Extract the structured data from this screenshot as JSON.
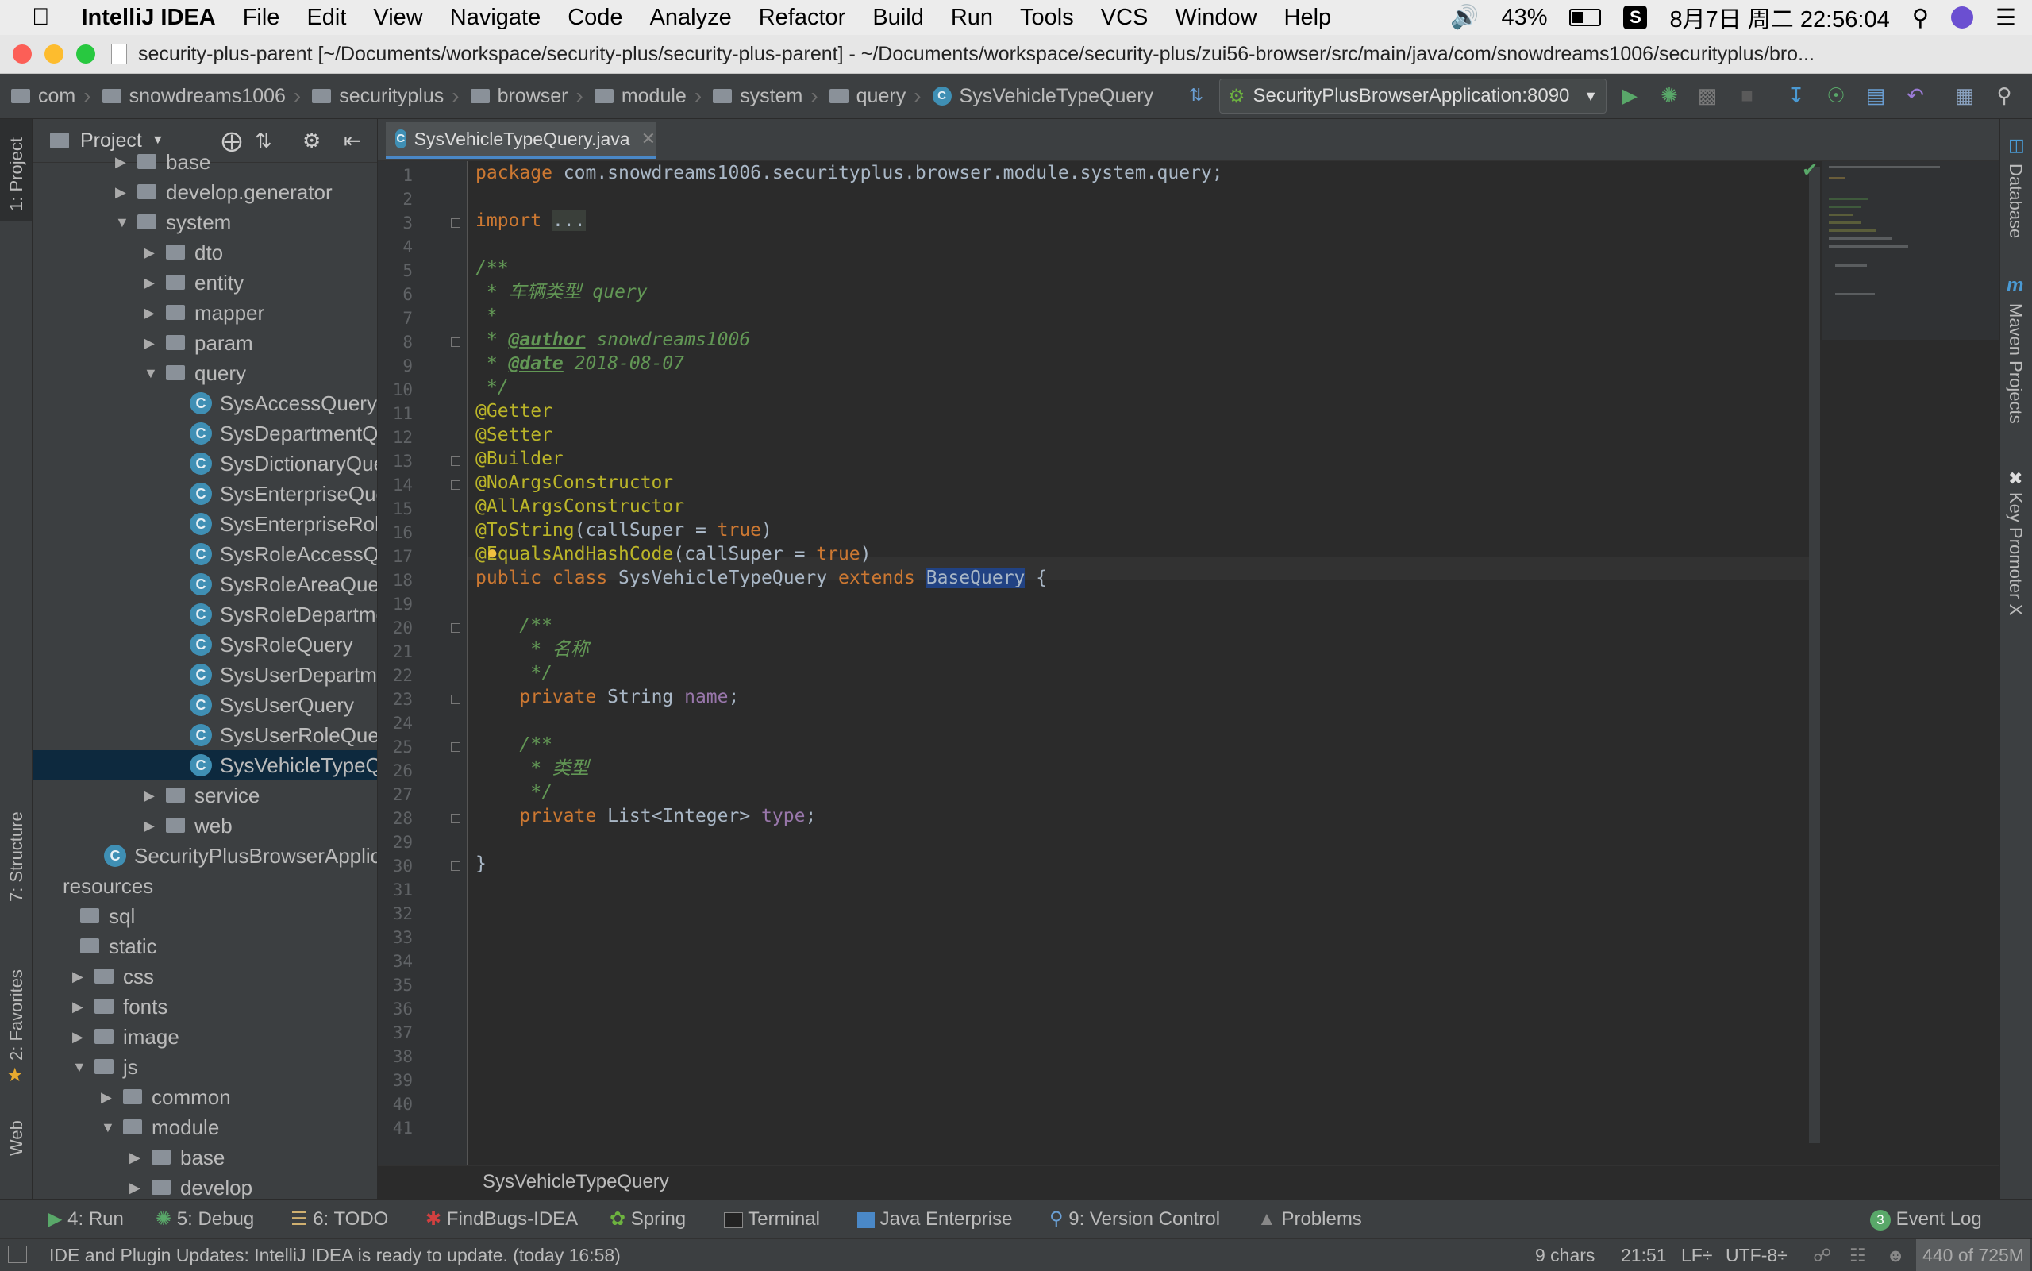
{
  "menubar": {
    "app": "IntelliJ IDEA",
    "items": [
      "File",
      "Edit",
      "View",
      "Navigate",
      "Code",
      "Analyze",
      "Refactor",
      "Build",
      "Run",
      "Tools",
      "VCS",
      "Window",
      "Help"
    ],
    "battery": "43%",
    "datetime": "8月7日 周二  22:56:04"
  },
  "window": {
    "title": "security-plus-parent [~/Documents/workspace/security-plus/security-plus-parent] - ~/Documents/workspace/security-plus/zui56-browser/src/main/java/com/snowdreams1006/securityplus/bro..."
  },
  "navbar": {
    "crumbs": [
      "com",
      "snowdreams1006",
      "securityplus",
      "browser",
      "module",
      "system",
      "query"
    ],
    "current": "SysVehicleTypeQuery",
    "run_config": "SecurityPlusBrowserApplication:8090"
  },
  "leftstrip": {
    "project_tab": "1: Project",
    "structure_tab": "7: Structure",
    "favorites_tab": "2: Favorites",
    "web_tab": "Web"
  },
  "project": {
    "title": "Project",
    "tree": [
      {
        "label": "base",
        "depth": 2,
        "kind": "folder",
        "arrow": "right"
      },
      {
        "label": "develop.generator",
        "depth": 2,
        "kind": "folder",
        "arrow": "right"
      },
      {
        "label": "system",
        "depth": 2,
        "kind": "folder",
        "arrow": "down"
      },
      {
        "label": "dto",
        "depth": 3,
        "kind": "folder",
        "arrow": "right"
      },
      {
        "label": "entity",
        "depth": 3,
        "kind": "folder",
        "arrow": "right"
      },
      {
        "label": "mapper",
        "depth": 3,
        "kind": "folder",
        "arrow": "right"
      },
      {
        "label": "param",
        "depth": 3,
        "kind": "folder",
        "arrow": "right"
      },
      {
        "label": "query",
        "depth": 3,
        "kind": "folder",
        "arrow": "down"
      },
      {
        "label": "SysAccessQuery",
        "depth": 4,
        "kind": "class"
      },
      {
        "label": "SysDepartmentQuery",
        "depth": 4,
        "kind": "class"
      },
      {
        "label": "SysDictionaryQuery",
        "depth": 4,
        "kind": "class"
      },
      {
        "label": "SysEnterpriseQuery",
        "depth": 4,
        "kind": "class"
      },
      {
        "label": "SysEnterpriseRoleQuery",
        "depth": 4,
        "kind": "class"
      },
      {
        "label": "SysRoleAccessQuery",
        "depth": 4,
        "kind": "class"
      },
      {
        "label": "SysRoleAreaQuery",
        "depth": 4,
        "kind": "class"
      },
      {
        "label": "SysRoleDepartmentQuery",
        "depth": 4,
        "kind": "class"
      },
      {
        "label": "SysRoleQuery",
        "depth": 4,
        "kind": "class"
      },
      {
        "label": "SysUserDepartmentQuery",
        "depth": 4,
        "kind": "class"
      },
      {
        "label": "SysUserQuery",
        "depth": 4,
        "kind": "class"
      },
      {
        "label": "SysUserRoleQuery",
        "depth": 4,
        "kind": "class"
      },
      {
        "label": "SysVehicleTypeQuery",
        "depth": 4,
        "kind": "class",
        "selected": true
      },
      {
        "label": "service",
        "depth": 3,
        "kind": "folder",
        "arrow": "right"
      },
      {
        "label": "web",
        "depth": 3,
        "kind": "folder",
        "arrow": "right"
      },
      {
        "label": "SecurityPlusBrowserApplication",
        "depth": 1,
        "kind": "app"
      },
      {
        "label": "resources",
        "depth": 0,
        "kind": "plain"
      },
      {
        "label": "sql",
        "depth": 0,
        "kind": "folder"
      },
      {
        "label": "static",
        "depth": 0,
        "kind": "folder"
      },
      {
        "label": "css",
        "depth": 0.5,
        "kind": "folder",
        "arrow": "right"
      },
      {
        "label": "fonts",
        "depth": 0.5,
        "kind": "folder",
        "arrow": "right"
      },
      {
        "label": "image",
        "depth": 0.5,
        "kind": "folder",
        "arrow": "right"
      },
      {
        "label": "js",
        "depth": 0.5,
        "kind": "folder",
        "arrow": "down"
      },
      {
        "label": "common",
        "depth": 1.5,
        "kind": "folder",
        "arrow": "right"
      },
      {
        "label": "module",
        "depth": 1.5,
        "kind": "folder",
        "arrow": "down"
      },
      {
        "label": "base",
        "depth": 2.5,
        "kind": "folder",
        "arrow": "right"
      },
      {
        "label": "develop",
        "depth": 2.5,
        "kind": "folder",
        "arrow": "right"
      }
    ]
  },
  "editor": {
    "tab": "SysVehicleTypeQuery.java",
    "line_count": 41,
    "current_line": 21,
    "breadcrumb": "SysVehicleTypeQuery"
  },
  "rightstrip": {
    "database_tab": "Database",
    "maven_tab": "Maven Projects",
    "keypromoter_tab": "Key Promoter X"
  },
  "toolwindows": {
    "run": "4: Run",
    "debug": "5: Debug",
    "todo": "6: TODO",
    "findbugs": "FindBugs-IDEA",
    "spring": "Spring",
    "terminal": "Terminal",
    "javaee": "Java Enterprise",
    "vcs": "9: Version Control",
    "problems": "Problems",
    "eventlog": "Event Log",
    "eventlog_count": "3"
  },
  "statusbar": {
    "message": "IDE and Plugin Updates: IntelliJ IDEA is ready to update. (today 16:58)",
    "chars": "9 chars",
    "position": "21:51",
    "line_sep": "LF÷",
    "encoding": "UTF-8÷",
    "memory": "440 of 725M"
  },
  "colors": {
    "keyword": "#cc7832",
    "annotation": "#bbb529",
    "comment": "#629755",
    "field": "#9876aa",
    "selection": "#0d293e",
    "accent": "#4a88c7"
  }
}
